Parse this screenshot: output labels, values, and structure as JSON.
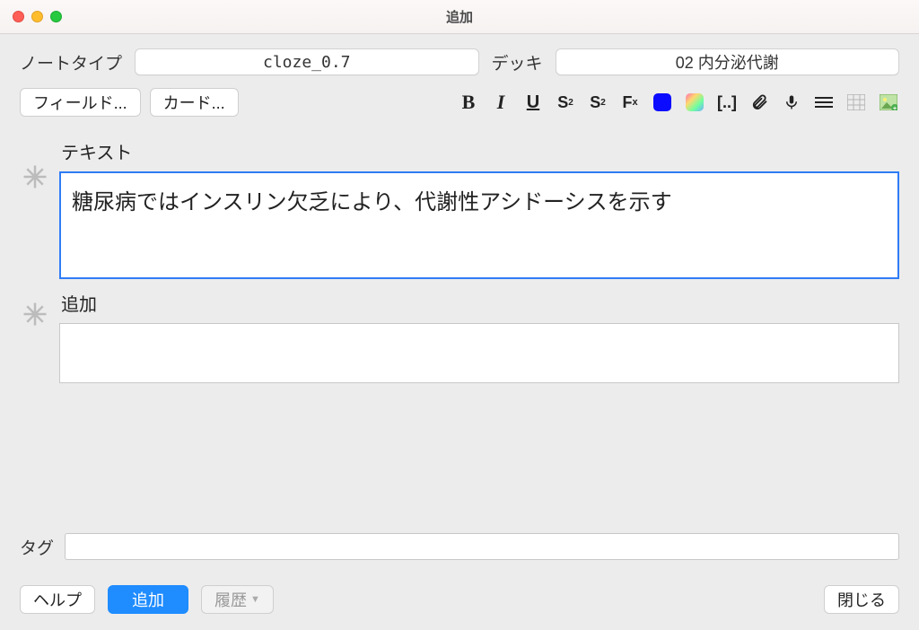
{
  "window": {
    "title": "追加"
  },
  "noteType": {
    "label": "ノートタイプ",
    "value": "cloze_0.7"
  },
  "deck": {
    "label": "デッキ",
    "value": "02 内分泌代謝"
  },
  "buttons": {
    "fields": "フィールド...",
    "cards": "カード...",
    "help": "ヘルプ",
    "add": "追加",
    "history": "履歴",
    "close": "閉じる"
  },
  "fields": [
    {
      "label": "テキスト",
      "value": "糖尿病ではインスリン欠乏により、代謝性アシドーシスを示す",
      "focused": true
    },
    {
      "label": "追加",
      "value": "",
      "focused": false
    }
  ],
  "tags": {
    "label": "タグ",
    "value": ""
  },
  "toolbarIcons": [
    "bold",
    "italic",
    "underline",
    "superscript",
    "subscript",
    "clear-format",
    "color-blue",
    "color-gradient",
    "cloze",
    "attach",
    "mic",
    "lines",
    "table",
    "image-occlusion"
  ]
}
